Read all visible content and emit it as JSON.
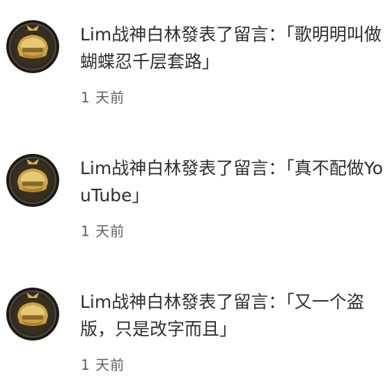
{
  "notifications": [
    {
      "message": "Lim战神白林發表了留言：「歌明明叫做蝴蝶忍千层套路」",
      "time": "1 天前",
      "avatar_icon": "gold-helmet-avatar"
    },
    {
      "message": "Lim战神白林發表了留言：「真不配做YouTube」",
      "time": "1 天前",
      "avatar_icon": "gold-helmet-avatar"
    },
    {
      "message": "Lim战神白林發表了留言：「又一个盗版，只是改字而且」",
      "time": "1 天前",
      "avatar_icon": "gold-helmet-avatar"
    }
  ]
}
